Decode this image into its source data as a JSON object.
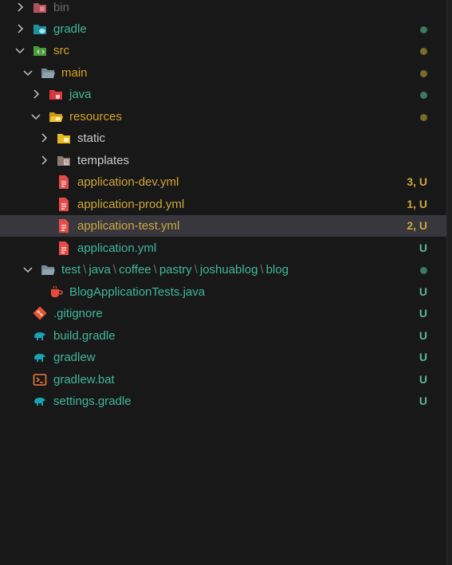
{
  "explorer": {
    "rows": [
      {
        "label": "bin",
        "icon": "folder-bin-icon",
        "status": ""
      },
      {
        "label": "gradle",
        "icon": "folder-gradle-icon",
        "status": "dot-green"
      },
      {
        "label": "src",
        "icon": "folder-src-icon",
        "status": "dot-yellow"
      },
      {
        "label": "main",
        "icon": "folder-open-icon",
        "status": "dot-yellow"
      },
      {
        "label": "java",
        "icon": "folder-java-icon",
        "status": "dot-green"
      },
      {
        "label": "resources",
        "icon": "folder-resources-open-icon",
        "status": "dot-yellow"
      },
      {
        "label": "static",
        "icon": "folder-static-icon",
        "status": ""
      },
      {
        "label": "templates",
        "icon": "folder-templates-icon",
        "status": ""
      },
      {
        "label": "application-dev.yml",
        "icon": "yaml-file-icon",
        "status": "3, U"
      },
      {
        "label": "application-prod.yml",
        "icon": "yaml-file-icon",
        "status": "1, U"
      },
      {
        "label": "application-test.yml",
        "icon": "yaml-file-icon",
        "status": "2, U"
      },
      {
        "label": "application.yml",
        "icon": "yaml-file-icon",
        "status": "U"
      },
      {
        "label": "test",
        "path": [
          "java",
          "coffee",
          "pastry",
          "joshuablog",
          "blog"
        ],
        "icon": "folder-open-icon",
        "status": "dot-green"
      },
      {
        "label": "BlogApplicationTests.java",
        "icon": "java-file-icon",
        "status": "U"
      },
      {
        "label": ".gitignore",
        "icon": "git-icon",
        "status": "U"
      },
      {
        "label": "build.gradle",
        "icon": "gradle-elephant-icon",
        "status": "U"
      },
      {
        "label": "gradlew",
        "icon": "gradle-elephant-icon",
        "status": "U"
      },
      {
        "label": "gradlew.bat",
        "icon": "terminal-icon",
        "status": "U"
      },
      {
        "label": "settings.gradle",
        "icon": "gradle-elephant-icon",
        "status": "U"
      }
    ]
  },
  "colors": {
    "background": "#181818",
    "selected_row": "#37373d",
    "untracked_green": "#3fb89a",
    "modified_yellow": "#d7a22b",
    "ignored_gray": "#6b6b6b"
  }
}
